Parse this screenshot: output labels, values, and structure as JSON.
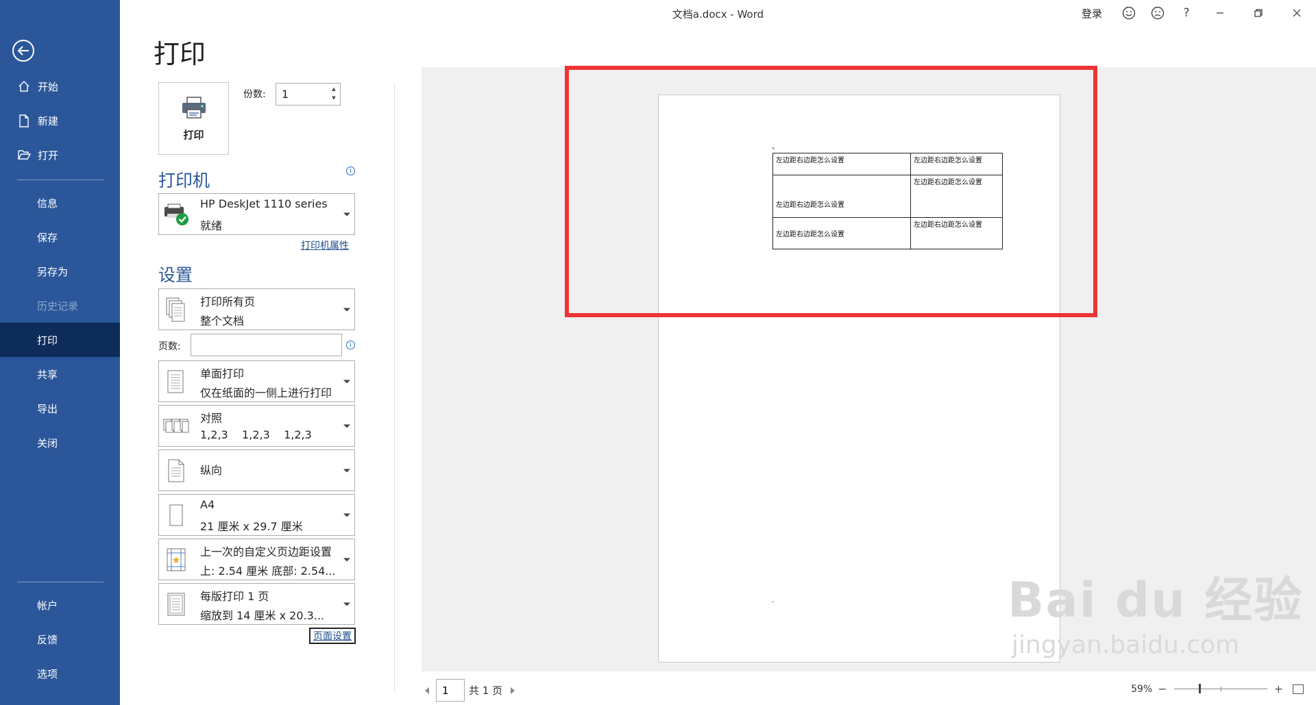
{
  "window": {
    "title": "文档a.docx  -  Word",
    "login": "登录",
    "help": "?"
  },
  "sidebar": {
    "items": [
      {
        "label": "开始",
        "icon": "home-icon"
      },
      {
        "label": "新建",
        "icon": "new-document-icon"
      },
      {
        "label": "打开",
        "icon": "open-folder-icon"
      },
      {
        "label": "信息"
      },
      {
        "label": "保存"
      },
      {
        "label": "另存为"
      },
      {
        "label": "历史记录"
      },
      {
        "label": "打印"
      },
      {
        "label": "共享"
      },
      {
        "label": "导出"
      },
      {
        "label": "关闭"
      },
      {
        "label": "帐户"
      },
      {
        "label": "反馈"
      },
      {
        "label": "选项"
      }
    ]
  },
  "print": {
    "heading": "打印",
    "button_label": "打印",
    "copies_label": "份数:",
    "copies_value": "1",
    "printer_section": "打印机",
    "printer_name": "HP DeskJet 1110 series",
    "printer_status": "就绪",
    "printer_properties": "打印机属性",
    "settings_section": "设置",
    "pages_label": "页数:",
    "page_setup": "页面设置",
    "settings": [
      {
        "line1": "打印所有页",
        "line2": "整个文档"
      },
      {
        "line1": "单面打印",
        "line2": "仅在纸面的一侧上进行打印"
      },
      {
        "line1": "对照",
        "line2": "1,2,3    1,2,3    1,2,3"
      },
      {
        "line1": "纵向",
        "line2": ""
      },
      {
        "line1": "A4",
        "line2": "21 厘米 x 29.7 厘米"
      },
      {
        "line1": "上一次的自定义页边距设置",
        "line2": "上: 2.54 厘米 底部: 2.54..."
      },
      {
        "line1": "每版打印 1 页",
        "line2": "缩放到 14 厘米 x 20.3..."
      }
    ]
  },
  "preview": {
    "top_mark": "、",
    "bottom_mark": ".",
    "table": [
      [
        "左边距右边距怎么设置",
        "左边距右边距怎么设置"
      ],
      [
        "左边距右边距怎么设置",
        "左边距右边距怎么设置"
      ],
      [
        "左边距右边距怎么设置",
        "左边距右边距怎么设置"
      ]
    ],
    "annotation_color": "#ed3436"
  },
  "pager": {
    "current": "1",
    "total_label": "共 1 页"
  },
  "zoom": {
    "percent": "59%",
    "minus": "−",
    "plus": "+",
    "level": 0.59
  },
  "watermark": {
    "main": "Bai du 经验",
    "sub": "jingyan.baidu.com"
  },
  "colors": {
    "sidebar": "#2b579a",
    "sidebar_active": "#0e2c5a",
    "accent": "#2b579a"
  }
}
